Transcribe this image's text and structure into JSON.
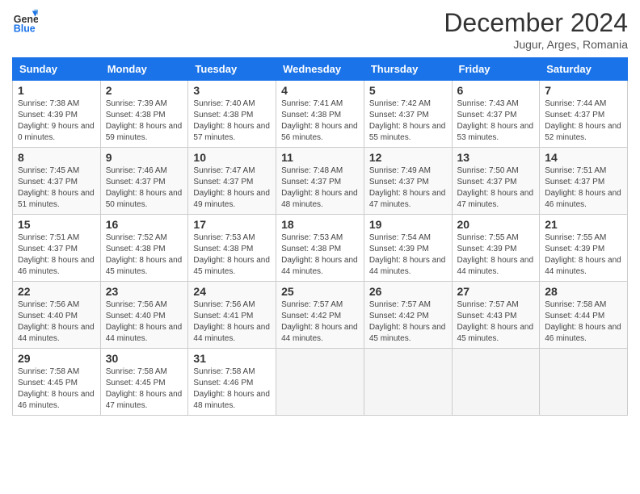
{
  "header": {
    "logo_line1": "General",
    "logo_line2": "Blue",
    "month": "December 2024",
    "location": "Jugur, Arges, Romania"
  },
  "columns": [
    "Sunday",
    "Monday",
    "Tuesday",
    "Wednesday",
    "Thursday",
    "Friday",
    "Saturday"
  ],
  "weeks": [
    [
      {
        "day": "1",
        "sunrise": "Sunrise: 7:38 AM",
        "sunset": "Sunset: 4:39 PM",
        "daylight": "Daylight: 9 hours and 0 minutes."
      },
      {
        "day": "2",
        "sunrise": "Sunrise: 7:39 AM",
        "sunset": "Sunset: 4:38 PM",
        "daylight": "Daylight: 8 hours and 59 minutes."
      },
      {
        "day": "3",
        "sunrise": "Sunrise: 7:40 AM",
        "sunset": "Sunset: 4:38 PM",
        "daylight": "Daylight: 8 hours and 57 minutes."
      },
      {
        "day": "4",
        "sunrise": "Sunrise: 7:41 AM",
        "sunset": "Sunset: 4:38 PM",
        "daylight": "Daylight: 8 hours and 56 minutes."
      },
      {
        "day": "5",
        "sunrise": "Sunrise: 7:42 AM",
        "sunset": "Sunset: 4:37 PM",
        "daylight": "Daylight: 8 hours and 55 minutes."
      },
      {
        "day": "6",
        "sunrise": "Sunrise: 7:43 AM",
        "sunset": "Sunset: 4:37 PM",
        "daylight": "Daylight: 8 hours and 53 minutes."
      },
      {
        "day": "7",
        "sunrise": "Sunrise: 7:44 AM",
        "sunset": "Sunset: 4:37 PM",
        "daylight": "Daylight: 8 hours and 52 minutes."
      }
    ],
    [
      {
        "day": "8",
        "sunrise": "Sunrise: 7:45 AM",
        "sunset": "Sunset: 4:37 PM",
        "daylight": "Daylight: 8 hours and 51 minutes."
      },
      {
        "day": "9",
        "sunrise": "Sunrise: 7:46 AM",
        "sunset": "Sunset: 4:37 PM",
        "daylight": "Daylight: 8 hours and 50 minutes."
      },
      {
        "day": "10",
        "sunrise": "Sunrise: 7:47 AM",
        "sunset": "Sunset: 4:37 PM",
        "daylight": "Daylight: 8 hours and 49 minutes."
      },
      {
        "day": "11",
        "sunrise": "Sunrise: 7:48 AM",
        "sunset": "Sunset: 4:37 PM",
        "daylight": "Daylight: 8 hours and 48 minutes."
      },
      {
        "day": "12",
        "sunrise": "Sunrise: 7:49 AM",
        "sunset": "Sunset: 4:37 PM",
        "daylight": "Daylight: 8 hours and 47 minutes."
      },
      {
        "day": "13",
        "sunrise": "Sunrise: 7:50 AM",
        "sunset": "Sunset: 4:37 PM",
        "daylight": "Daylight: 8 hours and 47 minutes."
      },
      {
        "day": "14",
        "sunrise": "Sunrise: 7:51 AM",
        "sunset": "Sunset: 4:37 PM",
        "daylight": "Daylight: 8 hours and 46 minutes."
      }
    ],
    [
      {
        "day": "15",
        "sunrise": "Sunrise: 7:51 AM",
        "sunset": "Sunset: 4:37 PM",
        "daylight": "Daylight: 8 hours and 46 minutes."
      },
      {
        "day": "16",
        "sunrise": "Sunrise: 7:52 AM",
        "sunset": "Sunset: 4:38 PM",
        "daylight": "Daylight: 8 hours and 45 minutes."
      },
      {
        "day": "17",
        "sunrise": "Sunrise: 7:53 AM",
        "sunset": "Sunset: 4:38 PM",
        "daylight": "Daylight: 8 hours and 45 minutes."
      },
      {
        "day": "18",
        "sunrise": "Sunrise: 7:53 AM",
        "sunset": "Sunset: 4:38 PM",
        "daylight": "Daylight: 8 hours and 44 minutes."
      },
      {
        "day": "19",
        "sunrise": "Sunrise: 7:54 AM",
        "sunset": "Sunset: 4:39 PM",
        "daylight": "Daylight: 8 hours and 44 minutes."
      },
      {
        "day": "20",
        "sunrise": "Sunrise: 7:55 AM",
        "sunset": "Sunset: 4:39 PM",
        "daylight": "Daylight: 8 hours and 44 minutes."
      },
      {
        "day": "21",
        "sunrise": "Sunrise: 7:55 AM",
        "sunset": "Sunset: 4:39 PM",
        "daylight": "Daylight: 8 hours and 44 minutes."
      }
    ],
    [
      {
        "day": "22",
        "sunrise": "Sunrise: 7:56 AM",
        "sunset": "Sunset: 4:40 PM",
        "daylight": "Daylight: 8 hours and 44 minutes."
      },
      {
        "day": "23",
        "sunrise": "Sunrise: 7:56 AM",
        "sunset": "Sunset: 4:40 PM",
        "daylight": "Daylight: 8 hours and 44 minutes."
      },
      {
        "day": "24",
        "sunrise": "Sunrise: 7:56 AM",
        "sunset": "Sunset: 4:41 PM",
        "daylight": "Daylight: 8 hours and 44 minutes."
      },
      {
        "day": "25",
        "sunrise": "Sunrise: 7:57 AM",
        "sunset": "Sunset: 4:42 PM",
        "daylight": "Daylight: 8 hours and 44 minutes."
      },
      {
        "day": "26",
        "sunrise": "Sunrise: 7:57 AM",
        "sunset": "Sunset: 4:42 PM",
        "daylight": "Daylight: 8 hours and 45 minutes."
      },
      {
        "day": "27",
        "sunrise": "Sunrise: 7:57 AM",
        "sunset": "Sunset: 4:43 PM",
        "daylight": "Daylight: 8 hours and 45 minutes."
      },
      {
        "day": "28",
        "sunrise": "Sunrise: 7:58 AM",
        "sunset": "Sunset: 4:44 PM",
        "daylight": "Daylight: 8 hours and 46 minutes."
      }
    ],
    [
      {
        "day": "29",
        "sunrise": "Sunrise: 7:58 AM",
        "sunset": "Sunset: 4:45 PM",
        "daylight": "Daylight: 8 hours and 46 minutes."
      },
      {
        "day": "30",
        "sunrise": "Sunrise: 7:58 AM",
        "sunset": "Sunset: 4:45 PM",
        "daylight": "Daylight: 8 hours and 47 minutes."
      },
      {
        "day": "31",
        "sunrise": "Sunrise: 7:58 AM",
        "sunset": "Sunset: 4:46 PM",
        "daylight": "Daylight: 8 hours and 48 minutes."
      },
      null,
      null,
      null,
      null
    ]
  ]
}
